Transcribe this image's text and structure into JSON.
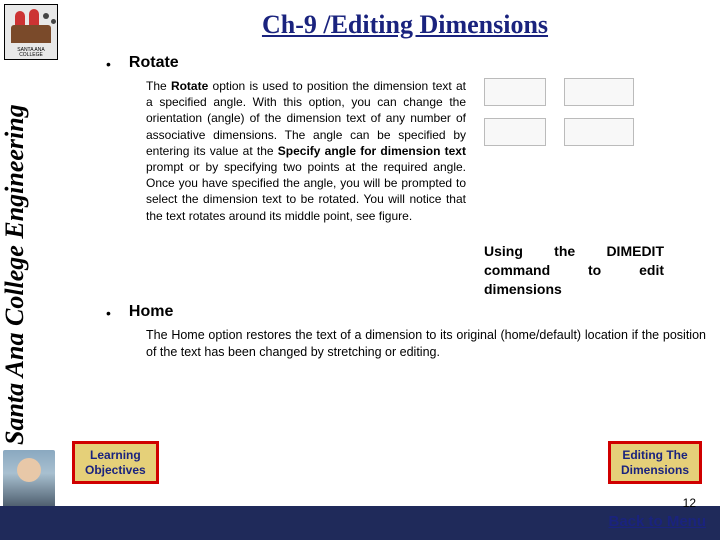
{
  "sidebar": {
    "college_label": "SANTA ANA COLLEGE",
    "vertical_title": "Santa Ana College Engineering"
  },
  "title": "Ch-9 /Editing Dimensions",
  "sections": {
    "rotate": {
      "heading": "Rotate",
      "body_pre": "The ",
      "body_bold1": "Rotate",
      "body_mid1": " option is used to position the dimension text at a specified angle. With this option, you can change the orientation (angle) of the dimension text of any number of associative dimensions. The angle can be specified by entering its value at the ",
      "body_bold2": "Specify angle for dimension text",
      "body_mid2": " prompt or by specifying two points at the required angle. Once you have specified the angle, you will be prompted to select the dimension text to be rotated. You will notice that the text rotates around its middle point, see figure.",
      "caption_pre": "Using the ",
      "caption_bold": "DIMEDIT",
      "caption_post": " command to edit dimensions"
    },
    "home": {
      "heading": "Home",
      "body": "The Home option restores the text of a dimension to its original (home/default) location if the position of the text has been changed by stretching or editing."
    }
  },
  "nav": {
    "left_line1": "Learning",
    "left_line2": "Objectives",
    "right_line1": "Editing The",
    "right_line2": "Dimensions"
  },
  "page_number": "12",
  "back_link": "Back to Menu"
}
